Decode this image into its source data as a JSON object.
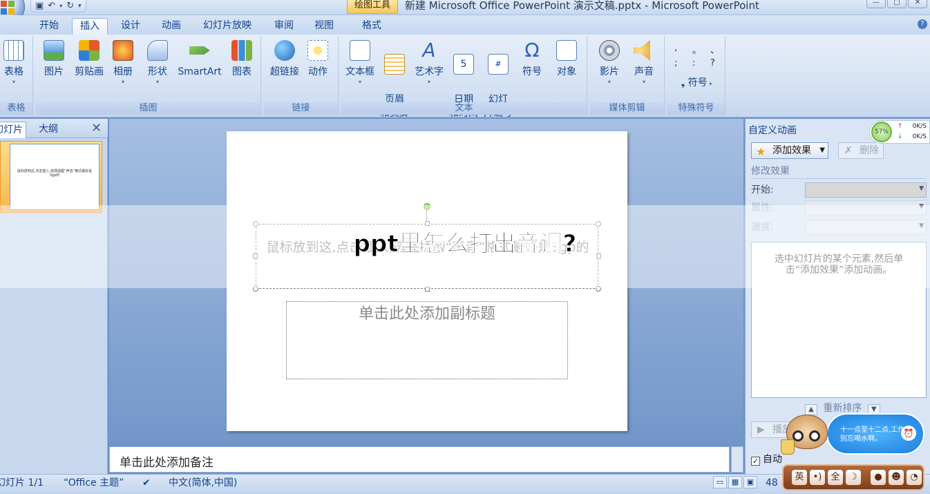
{
  "titlebar": {
    "context_tab": "绘图工具",
    "window_title": "新建 Microsoft Office PowerPoint 演示文稿.pptx - Microsoft PowerPoint",
    "qat_icons": [
      "save-icon",
      "undo-icon",
      "redo-icon",
      "customize-qat-icon"
    ]
  },
  "ribbon_tabs": [
    "开始",
    "插入",
    "设计",
    "动画",
    "幻灯片放映",
    "审阅",
    "视图",
    "格式"
  ],
  "active_tab": "插入",
  "ribbon": {
    "groups": [
      {
        "label": "表格",
        "buttons": [
          "表格"
        ]
      },
      {
        "label": "插图",
        "buttons": [
          "图片",
          "剪贴画",
          "相册",
          "形状",
          "SmartArt",
          "图表"
        ]
      },
      {
        "label": "链接",
        "buttons": [
          "超链接",
          "动作"
        ]
      },
      {
        "label": "文本",
        "buttons": [
          "文本框",
          "页眉\n和页脚",
          "艺术字",
          "日期\n和时间",
          "幻灯\n片编号",
          "符号",
          "对象"
        ]
      },
      {
        "label": "媒体剪辑",
        "buttons": [
          "影片",
          "声音"
        ]
      },
      {
        "label": "特殊符号",
        "buttons": [
          "符号"
        ]
      }
    ],
    "special_symbols": [
      ",",
      "。",
      "、",
      ";",
      ":",
      "?"
    ]
  },
  "left_pane": {
    "tab_slides": "幻灯片",
    "tab_outline": "大纲",
    "thumb_text": "鼠标放到这,点击插入,选择插图“声音”格式最好是3gp的"
  },
  "slide": {
    "title_text": "鼠标放到这,点击插入,选择插图“声音”格式最好是3gp的",
    "subtitle_placeholder": "单击此处添加副标题"
  },
  "notes_placeholder": "单击此处添加备注",
  "task_pane": {
    "title": "自定义动画",
    "add_effect": "添加效果",
    "remove": "删除",
    "modify_section": "修改效果",
    "start_label": "开始:",
    "property_label": "属性:",
    "speed_label": "速度:",
    "hint": "选中幻灯片的某个元素,然后单击“添加效果”添加动画。",
    "reorder_label": "重新排序",
    "play_label": "播放",
    "autopreview_label": "自动"
  },
  "statusbar": {
    "slide_info": "幻灯片 1/1",
    "theme": "“Office 主题”",
    "language": "中文(简体,中国)",
    "zoom": "48"
  },
  "network_widget": {
    "percent": "57%",
    "upload": "0K/S",
    "download": "0K/S"
  },
  "mascot": {
    "bubble_text": "十一点至十二点,工作别忘喝水啊。",
    "ime_buttons": [
      "英",
      "•)",
      "全",
      "☽"
    ]
  },
  "banner": {
    "text": "ppt里怎么打出音调?"
  }
}
